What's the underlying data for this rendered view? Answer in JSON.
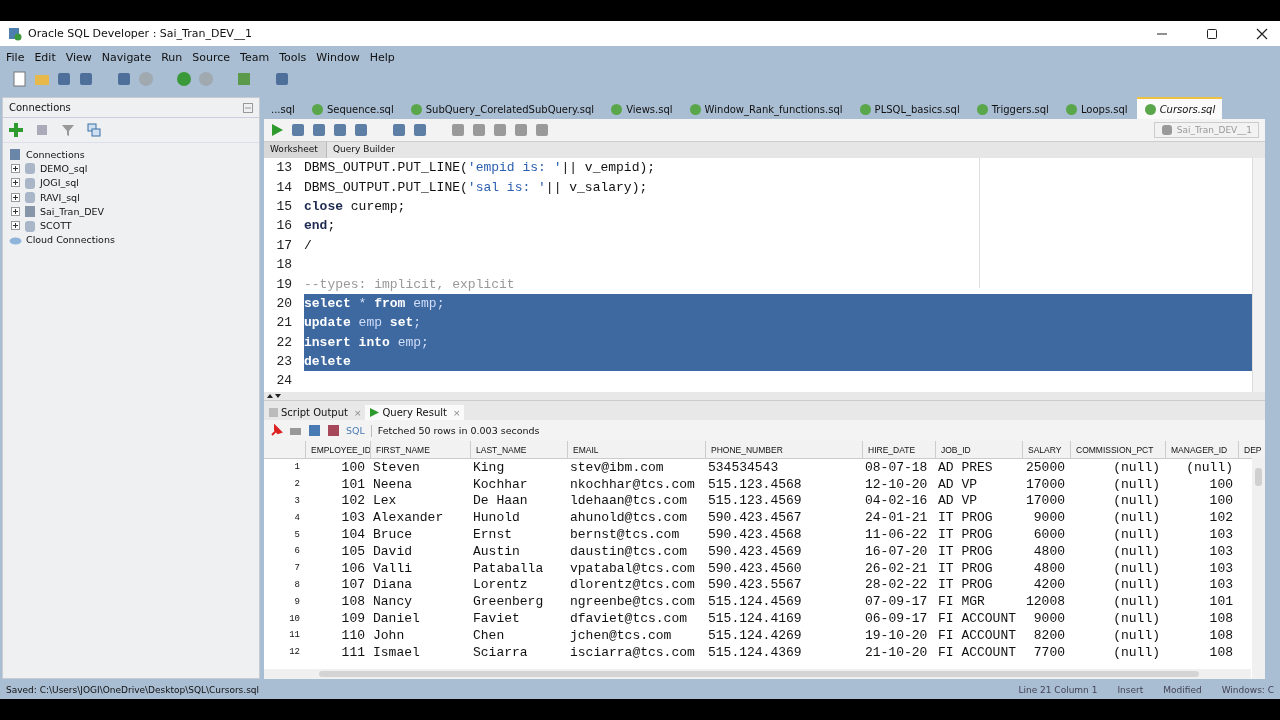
{
  "window": {
    "title": "Oracle SQL Developer : Sai_Tran_DEV__1"
  },
  "menu": [
    "File",
    "Edit",
    "View",
    "Navigate",
    "Run",
    "Source",
    "Team",
    "Tools",
    "Window",
    "Help"
  ],
  "connections_panel": {
    "title": "Connections",
    "tree": [
      {
        "label": "Connections",
        "kind": "root",
        "children": [
          {
            "label": "DEMO_sql",
            "kind": "db",
            "expanded": false
          },
          {
            "label": "JOGI_sql",
            "kind": "db",
            "expanded": false
          },
          {
            "label": "RAVI_sql",
            "kind": "db",
            "expanded": false
          },
          {
            "label": "Sai_Tran_DEV",
            "kind": "dbconn",
            "expanded": false
          },
          {
            "label": "SCOTT",
            "kind": "db",
            "expanded": false
          }
        ]
      },
      {
        "label": "Cloud Connections",
        "kind": "cloud"
      }
    ]
  },
  "editor_tabs": [
    {
      "label": "...sql",
      "selected": false,
      "icon": false
    },
    {
      "label": "Sequence.sql",
      "selected": false,
      "icon": true
    },
    {
      "label": "SubQuery_CorelatedSubQuery.sql",
      "selected": false,
      "icon": true
    },
    {
      "label": "Views.sql",
      "selected": false,
      "icon": true
    },
    {
      "label": "Window_Rank_functions.sql",
      "selected": false,
      "icon": true
    },
    {
      "label": "PLSQL_basics.sql",
      "selected": false,
      "icon": true
    },
    {
      "label": "Triggers.sql",
      "selected": false,
      "icon": true
    },
    {
      "label": "Loops.sql",
      "selected": false,
      "icon": true
    },
    {
      "label": "Cursors.sql",
      "selected": true,
      "icon": true
    }
  ],
  "connection_selector": "Sai_Tran_DEV__1",
  "worksheet_tabs": [
    {
      "label": "Worksheet",
      "selected": true
    },
    {
      "label": "Query Builder",
      "selected": false
    }
  ],
  "code_lines": [
    {
      "number": "13",
      "selected": false,
      "segments": [
        {
          "kind": "plain",
          "text": "DBMS_OUTPUT.PUT_LINE("
        },
        {
          "kind": "str",
          "text": "'empid is: '"
        },
        {
          "kind": "plain",
          "text": "|| v_empid);"
        }
      ]
    },
    {
      "number": "14",
      "selected": false,
      "segments": [
        {
          "kind": "plain",
          "text": "DBMS_OUTPUT.PUT_LINE("
        },
        {
          "kind": "str",
          "text": "'sal is: '"
        },
        {
          "kind": "plain",
          "text": "|| v_salary);"
        }
      ]
    },
    {
      "number": "15",
      "selected": false,
      "segments": [
        {
          "kind": "kw",
          "text": "close"
        },
        {
          "kind": "plain",
          "text": " curemp;"
        }
      ]
    },
    {
      "number": "16",
      "selected": false,
      "segments": [
        {
          "kind": "kw",
          "text": "end"
        },
        {
          "kind": "plain",
          "text": ";"
        }
      ]
    },
    {
      "number": "17",
      "selected": false,
      "segments": [
        {
          "kind": "plain",
          "text": "/"
        }
      ]
    },
    {
      "number": "18",
      "selected": false
    },
    {
      "number": "19",
      "selected": false,
      "segments": [
        {
          "kind": "comment",
          "text": "--types: implicit, explicit"
        }
      ]
    },
    {
      "number": "20",
      "selected": true,
      "segments": [
        {
          "kind": "kw",
          "text": "select"
        },
        {
          "kind": "plain",
          "text": " * "
        },
        {
          "kind": "kw",
          "text": "from"
        },
        {
          "kind": "id",
          "text": " emp;"
        }
      ]
    },
    {
      "number": "21",
      "selected": true,
      "segments": [
        {
          "kind": "kw",
          "text": "update"
        },
        {
          "kind": "id",
          "text": " emp "
        },
        {
          "kind": "kw",
          "text": "set"
        },
        {
          "kind": "plain",
          "text": ";"
        }
      ]
    },
    {
      "number": "22",
      "selected": true,
      "segments": [
        {
          "kind": "kw",
          "text": "insert into"
        },
        {
          "kind": "id",
          "text": " emp;"
        }
      ]
    },
    {
      "number": "23",
      "selected": true,
      "segments": [
        {
          "kind": "kw",
          "text": "delete"
        }
      ]
    },
    {
      "number": "24",
      "selected": false
    }
  ],
  "output_tabs": [
    {
      "label": "Script Output",
      "selected": false,
      "close": "×"
    },
    {
      "label": "Query Result",
      "selected": true,
      "close": "×"
    }
  ],
  "result_toolbar": {
    "sql_label": "SQL",
    "message": "Fetched 50 rows in 0.003 seconds"
  },
  "table": {
    "columns": [
      "",
      "EMPLOYEE_ID",
      "FIRST_NAME",
      "LAST_NAME",
      "EMAIL",
      "PHONE_NUMBER",
      "HIRE_DATE",
      "JOB_ID",
      "SALARY",
      "COMMISSION_PCT",
      "MANAGER_ID",
      "DEP"
    ],
    "rows": [
      [
        "1",
        "100",
        "Steven",
        "King",
        "stev@ibm.com",
        "534534543",
        "08-07-18",
        "AD PRES",
        "25000",
        "(null)",
        "(null)"
      ],
      [
        "2",
        "101",
        "Neena",
        "Kochhar",
        "nkochhar@tcs.com",
        "515.123.4568",
        "12-10-20",
        "AD VP",
        "17000",
        "(null)",
        "100"
      ],
      [
        "3",
        "102",
        "Lex",
        "De Haan",
        "ldehaan@tcs.com",
        "515.123.4569",
        "04-02-16",
        "AD VP",
        "17000",
        "(null)",
        "100"
      ],
      [
        "4",
        "103",
        "Alexander",
        "Hunold",
        "ahunold@tcs.com",
        "590.423.4567",
        "24-01-21",
        "IT PROG",
        "9000",
        "(null)",
        "102"
      ],
      [
        "5",
        "104",
        "Bruce",
        "Ernst",
        "bernst@tcs.com",
        "590.423.4568",
        "11-06-22",
        "IT PROG",
        "6000",
        "(null)",
        "103"
      ],
      [
        "6",
        "105",
        "David",
        "Austin",
        "daustin@tcs.com",
        "590.423.4569",
        "16-07-20",
        "IT PROG",
        "4800",
        "(null)",
        "103"
      ],
      [
        "7",
        "106",
        "Valli",
        "Pataballa",
        "vpatabal@tcs.com",
        "590.423.4560",
        "26-02-21",
        "IT PROG",
        "4800",
        "(null)",
        "103"
      ],
      [
        "8",
        "107",
        "Diana",
        "Lorentz",
        "dlorentz@tcs.com",
        "590.423.5567",
        "28-02-22",
        "IT PROG",
        "4200",
        "(null)",
        "103"
      ],
      [
        "9",
        "108",
        "Nancy",
        "Greenberg",
        "ngreenbe@tcs.com",
        "515.124.4569",
        "07-09-17",
        "FI MGR",
        "12008",
        "(null)",
        "101"
      ],
      [
        "10",
        "109",
        "Daniel",
        "Faviet",
        "dfaviet@tcs.com",
        "515.124.4169",
        "06-09-17",
        "FI ACCOUNT",
        "9000",
        "(null)",
        "108"
      ],
      [
        "11",
        "110",
        "John",
        "Chen",
        "jchen@tcs.com",
        "515.124.4269",
        "19-10-20",
        "FI ACCOUNT",
        "8200",
        "(null)",
        "108"
      ],
      [
        "12",
        "111",
        "Ismael",
        "Sciarra",
        "isciarra@tcs.com",
        "515.124.4369",
        "21-10-20",
        "FI ACCOUNT",
        "7700",
        "(null)",
        "108"
      ]
    ]
  },
  "status_bar": {
    "saved": "Saved: C:\\Users\\JOGI\\OneDrive\\Desktop\\SQL\\Cursors.sql",
    "position": "Line 21 Column 1",
    "mode": "Insert",
    "state": "Modified",
    "os": "Windows: C"
  }
}
